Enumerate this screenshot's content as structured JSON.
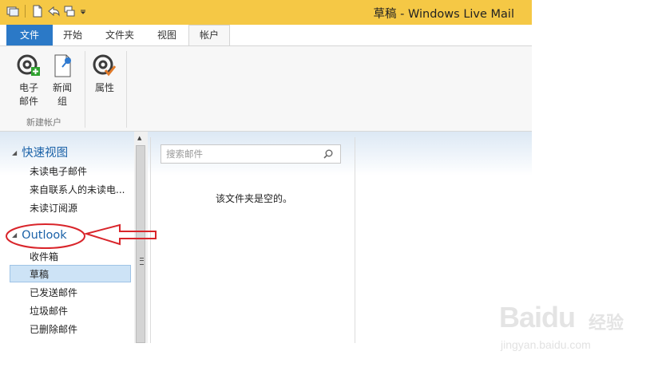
{
  "window": {
    "title": "草稿 - Windows Live Mail"
  },
  "colors": {
    "titlebar": "#f5c845",
    "file_tab": "#2b79c7",
    "accent_text": "#1b62a8",
    "selection": "#cde3f6",
    "annotation": "#d9252b"
  },
  "ribbon": {
    "tabs": [
      "文件",
      "开始",
      "文件夹",
      "视图",
      "帐户"
    ],
    "active_tab": "帐户",
    "buttons": [
      {
        "label": "电子\n邮件",
        "icon": "email-account-add-icon"
      },
      {
        "label": "新闻\n组",
        "icon": "newsgroup-icon"
      },
      {
        "label": "属性",
        "icon": "properties-icon"
      }
    ],
    "group_label": "新建帐户"
  },
  "nav": {
    "quick_views": {
      "label": "快速视图",
      "items": [
        "未读电子邮件",
        "来自联系人的未读电...",
        "未读订阅源"
      ]
    },
    "outlook": {
      "label": "Outlook",
      "items": [
        "收件箱",
        "草稿",
        "已发送邮件",
        "垃圾邮件",
        "已删除邮件"
      ]
    },
    "selected": "草稿"
  },
  "search": {
    "placeholder": "搜索邮件"
  },
  "message_list": {
    "empty_text": "该文件夹是空的。"
  },
  "watermark": {
    "brand": "Baidu",
    "brand_cn": "经验",
    "url": "jingyan.baidu.com"
  }
}
